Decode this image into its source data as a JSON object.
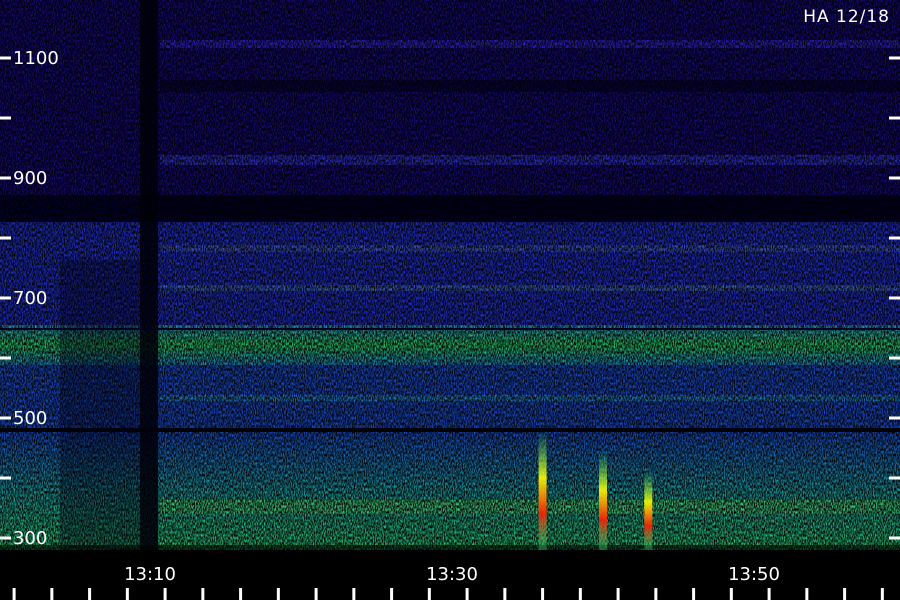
{
  "chart_data": {
    "type": "heatmap",
    "title": "HA 12/18",
    "xlabel": "",
    "ylabel": "",
    "x_ticks": [
      "13:10",
      "13:30",
      "13:50"
    ],
    "y_ticks": [
      300,
      500,
      700,
      900,
      1100
    ],
    "ylim": [
      290,
      1180
    ],
    "colormap": [
      "#000000",
      "#1a0a8c",
      "#2040ff",
      "#20a0ff",
      "#20ff90",
      "#ffff00",
      "#ff2000"
    ],
    "bands": [
      {
        "y_from": 640,
        "y_to": 610,
        "intensity": "high"
      },
      {
        "y_from": 470,
        "y_to": 300,
        "intensity": "high"
      },
      {
        "y_from": 600,
        "y_to": 480,
        "intensity": "medium"
      },
      {
        "y_from": 820,
        "y_to": 660,
        "intensity": "medium"
      }
    ],
    "bursts": [
      {
        "time": "13:36",
        "intensity": "peak"
      },
      {
        "time": "13:40",
        "intensity": "peak"
      },
      {
        "time": "13:43",
        "intensity": "peak"
      }
    ]
  }
}
